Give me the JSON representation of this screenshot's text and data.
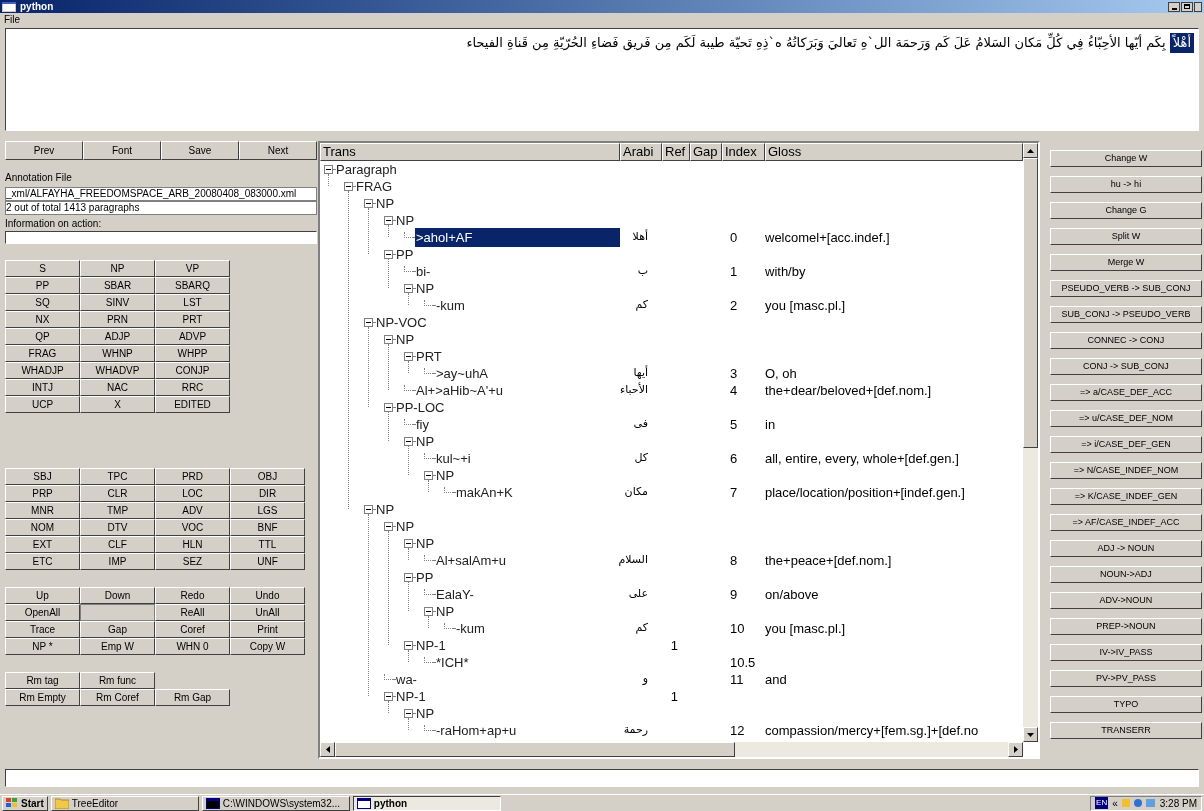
{
  "window": {
    "title": "python",
    "menu": [
      "File"
    ]
  },
  "sentence": {
    "highlighted": "أَهْلاً",
    "rest": "بِكَم أيّها الأحِبّاءُ فِي كُلِّ مَكان السَلامُ عَلَ  كَم وَرَحمَة الل`هِ تَعاليَ وَبَرَكاتُهُ ه`ذِهِ تَحيّة طيبة لَكَم مِن فَريق فَضاءِ الحُرّيّةِ مِن قَناةِ الفيحاء"
  },
  "nav_buttons": [
    "Prev",
    "Font",
    "Save",
    "Next"
  ],
  "annotation": {
    "file_label": "Annotation File",
    "file": "_xml/ALFAYHA_FREEDOMSPACE_ARB_20080408_083000.xml",
    "progress": "2 out of total 1413 paragraphs",
    "info_label": "Information on action:"
  },
  "tag_buttons": [
    "S",
    "NP",
    "VP",
    "PP",
    "SBAR",
    "SBARQ",
    "SQ",
    "SINV",
    "LST",
    "NX",
    "PRN",
    "PRT",
    "QP",
    "ADJP",
    "ADVP",
    "FRAG",
    "WHNP",
    "WHPP",
    "WHADJP",
    "WHADVP",
    "CONJP",
    "INTJ",
    "NAC",
    "RRC",
    "UCP",
    "X",
    "EDITED"
  ],
  "function_buttons": [
    "SBJ",
    "TPC",
    "PRD",
    "OBJ",
    "PRP",
    "CLR",
    "LOC",
    "DIR",
    "MNR",
    "TMP",
    "ADV",
    "LGS",
    "NOM",
    "DTV",
    "VOC",
    "BNF",
    "EXT",
    "CLF",
    "HLN",
    "TTL",
    "ETC",
    "IMP",
    "SEZ",
    "UNF"
  ],
  "action_rows": [
    [
      "Up",
      "Down",
      "Redo",
      "Undo"
    ],
    [
      "OpenAll",
      null,
      "ReAll",
      "UnAll"
    ],
    [
      "Trace",
      "Gap",
      "Coref",
      "Print"
    ],
    [
      "NP *",
      "Emp W",
      "WHN 0",
      "Copy W"
    ]
  ],
  "remove_rows": [
    [
      "Rm tag",
      "Rm func"
    ],
    [
      "Rm Empty",
      "Rm Coref",
      "Rm Gap"
    ]
  ],
  "tree": {
    "columns": [
      "Trans",
      "Arabi",
      "Ref",
      "Gap",
      "Index",
      "Gloss"
    ],
    "nodes": [
      {
        "trans": "Paragraph",
        "selected": false,
        "expanded": true,
        "children": [
          {
            "trans": "FRAG",
            "selected": false,
            "expanded": true,
            "children": [
              {
                "trans": "NP",
                "selected": false,
                "expanded": true,
                "children": [
                  {
                    "trans": "NP",
                    "selected": false,
                    "expanded": true,
                    "children": [
                      {
                        "trans": ">ahol+AF",
                        "arabic": "أهلا",
                        "index": "0",
                        "gloss": "welcomel+[acc.indef.]",
                        "selected": true
                      }
                    ]
                  },
                  {
                    "trans": "PP",
                    "selected": false,
                    "expanded": true,
                    "children": [
                      {
                        "trans": "bi-",
                        "arabic": "ب",
                        "index": "1",
                        "gloss": "with/by",
                        "selected": false
                      },
                      {
                        "trans": "NP",
                        "selected": false,
                        "expanded": true,
                        "children": [
                          {
                            "trans": "-kum",
                            "arabic": "كم",
                            "index": "2",
                            "gloss": "you [masc.pl.]",
                            "selected": false
                          }
                        ]
                      }
                    ]
                  }
                ]
              },
              {
                "trans": "NP-VOC",
                "selected": false,
                "expanded": true,
                "children": [
                  {
                    "trans": "NP",
                    "selected": false,
                    "expanded": true,
                    "children": [
                      {
                        "trans": "PRT",
                        "selected": false,
                        "expanded": true,
                        "children": [
                          {
                            "trans": ">ay~uhA",
                            "arabic": "أيها",
                            "index": "3",
                            "gloss": "O, oh",
                            "selected": false
                          }
                        ]
                      },
                      {
                        "trans": "Al+>aHib~A'+u",
                        "arabic": "الأحباء",
                        "index": "4",
                        "gloss": "the+dear/beloved+[def.nom.]",
                        "selected": false
                      }
                    ]
                  },
                  {
                    "trans": "PP-LOC",
                    "selected": false,
                    "expanded": true,
                    "children": [
                      {
                        "trans": "fiy",
                        "arabic": "فى",
                        "index": "5",
                        "gloss": "in",
                        "selected": false
                      },
                      {
                        "trans": "NP",
                        "selected": false,
                        "expanded": true,
                        "children": [
                          {
                            "trans": "kul~+i",
                            "arabic": "كل",
                            "index": "6",
                            "gloss": "all, entire, every, whole+[def.gen.]",
                            "selected": false
                          },
                          {
                            "trans": "NP",
                            "selected": false,
                            "expanded": true,
                            "children": [
                              {
                                "trans": "makAn+K",
                                "arabic": "مكان",
                                "index": "7",
                                "gloss": "place/location/position+[indef.gen.]",
                                "selected": false
                              }
                            ]
                          }
                        ]
                      }
                    ]
                  }
                ]
              },
              {
                "trans": "NP",
                "selected": false,
                "expanded": true,
                "children": [
                  {
                    "trans": "NP",
                    "selected": false,
                    "expanded": true,
                    "children": [
                      {
                        "trans": "NP",
                        "selected": false,
                        "expanded": true,
                        "children": [
                          {
                            "trans": "Al+salAm+u",
                            "arabic": "السلام",
                            "index": "8",
                            "gloss": "the+peace+[def.nom.]",
                            "selected": false
                          }
                        ]
                      },
                      {
                        "trans": "PP",
                        "selected": false,
                        "expanded": true,
                        "children": [
                          {
                            "trans": "EalaY-",
                            "arabic": "على",
                            "index": "9",
                            "gloss": "on/above",
                            "selected": false
                          },
                          {
                            "trans": "NP",
                            "selected": false,
                            "expanded": true,
                            "children": [
                              {
                                "trans": "-kum",
                                "arabic": "كم",
                                "index": "10",
                                "gloss": "you [masc.pl.]",
                                "selected": false
                              }
                            ]
                          }
                        ]
                      },
                      {
                        "trans": "NP-1",
                        "ref": "1",
                        "selected": false,
                        "expanded": true,
                        "children": [
                          {
                            "trans": "*ICH*",
                            "index": "10.5",
                            "selected": false
                          }
                        ]
                      }
                    ]
                  },
                  {
                    "trans": "wa-",
                    "arabic": "و",
                    "index": "11",
                    "gloss": "and",
                    "selected": false
                  },
                  {
                    "trans": "NP-1",
                    "ref": "1",
                    "selected": false,
                    "expanded": true,
                    "children": [
                      {
                        "trans": "NP",
                        "selected": false,
                        "expanded": true,
                        "children": [
                          {
                            "trans": "-raHom+ap+u",
                            "arabic": "رحمة",
                            "index": "12",
                            "gloss": "compassion/mercy+[fem.sg.]+[def.no",
                            "selected": false
                          }
                        ]
                      }
                    ]
                  }
                ]
              }
            ]
          }
        ]
      }
    ]
  },
  "right_buttons": [
    "Change W",
    "hu -> hi",
    "Change G",
    "Split W",
    "Merge W",
    "PSEUDO_VERB -> SUB_CONJ",
    "SUB_CONJ -> PSEUDO_VERB",
    "CONNEC -> CONJ",
    "CONJ -> SUB_CONJ",
    "=> a/CASE_DEF_ACC",
    "=> u/CASE_DEF_NOM",
    "=> i/CASE_DEF_GEN",
    "=> N/CASE_INDEF_NOM",
    "=> K/CASE_INDEF_GEN",
    "=> AF/CASE_INDEF_ACC",
    "ADJ -> NOUN",
    "NOUN->ADJ",
    "ADV->NOUN",
    "PREP->NOUN",
    "IV->IV_PASS",
    "PV->PV_PASS",
    "TYPO",
    "TRANSERR"
  ],
  "taskbar": {
    "start": "Start",
    "tasks": [
      {
        "kind": "folder",
        "label": "TreeEditor",
        "selected": false
      },
      {
        "kind": "console",
        "label": "C:\\WINDOWS\\system32...",
        "selected": false
      },
      {
        "kind": "window",
        "label": "python",
        "selected": true
      }
    ],
    "language": "EN",
    "tray_toggle": "«",
    "time": "3:28 PM"
  }
}
